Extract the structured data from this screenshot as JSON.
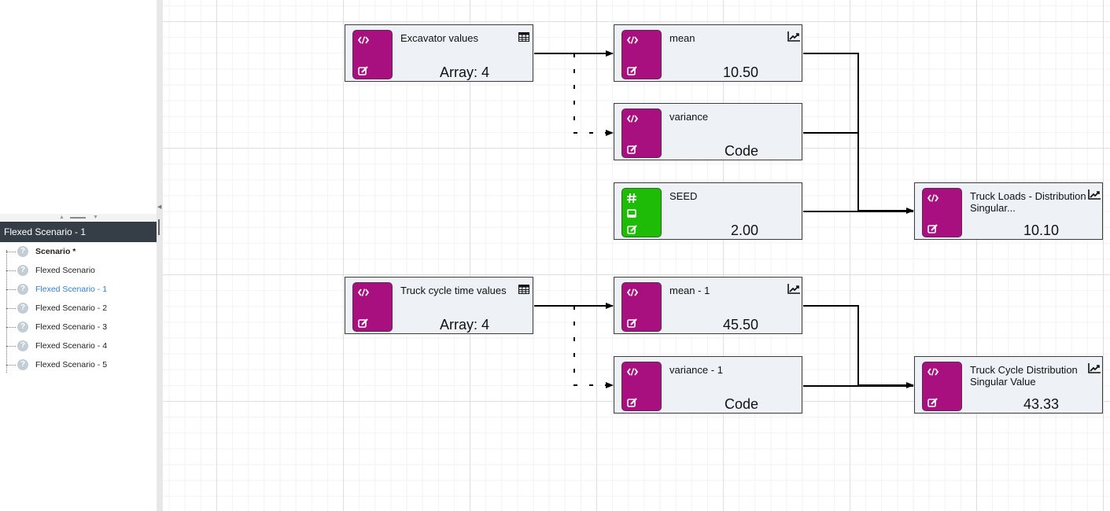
{
  "sidebar": {
    "panel_title": "Flexed Scenario - 1",
    "tree": [
      {
        "label": "Scenario *",
        "style": "bold",
        "icon": "question-icon"
      },
      {
        "label": "Flexed Scenario",
        "style": "normal",
        "icon": "question-icon"
      },
      {
        "label": "Flexed Scenario - 1",
        "style": "active",
        "icon": "question-icon"
      },
      {
        "label": "Flexed Scenario - 2",
        "style": "normal",
        "icon": "question-icon"
      },
      {
        "label": "Flexed Scenario - 3",
        "style": "normal",
        "icon": "question-icon"
      },
      {
        "label": "Flexed Scenario - 4",
        "style": "normal",
        "icon": "question-icon"
      },
      {
        "label": "Flexed Scenario - 5",
        "style": "normal",
        "icon": "question-icon"
      }
    ]
  },
  "colors": {
    "code_node": "#a8107f",
    "input_node": "#1ebc07",
    "active_item": "#2d7fd8",
    "panel_header": "#353e46"
  },
  "nodes": {
    "excavator_values": {
      "title": "Excavator values",
      "value": "Array:  4",
      "type": "code",
      "corner_icon": "table-icon"
    },
    "mean": {
      "title": "mean",
      "value": "10.50",
      "type": "code",
      "corner_icon": "chart-icon"
    },
    "variance": {
      "title": "variance",
      "value": "Code",
      "type": "code",
      "corner_icon": ""
    },
    "seed": {
      "title": "SEED",
      "value": "2.00",
      "type": "input",
      "corner_icon": ""
    },
    "truck_loads": {
      "title": "Truck Loads - Distribution Singular...",
      "value": "10.10",
      "type": "code",
      "corner_icon": "chart-icon"
    },
    "truck_cycle_values": {
      "title": "Truck cycle time values",
      "value": "Array:  4",
      "type": "code",
      "corner_icon": "table-icon"
    },
    "mean_1": {
      "title": "mean - 1",
      "value": "45.50",
      "type": "code",
      "corner_icon": "chart-icon"
    },
    "variance_1": {
      "title": "variance - 1",
      "value": "Code",
      "type": "code",
      "corner_icon": ""
    },
    "truck_cycle_dist": {
      "title": "Truck Cycle Distribution Singular Value",
      "value": "43.33",
      "type": "code",
      "corner_icon": "chart-icon"
    }
  },
  "edges": [
    {
      "from": "excavator_values",
      "to": "mean",
      "style": "solid"
    },
    {
      "from": "excavator_values",
      "to": "variance",
      "style": "dashed"
    },
    {
      "from": "mean",
      "to": "truck_loads",
      "style": "solid"
    },
    {
      "from": "variance",
      "to": "truck_loads",
      "style": "solid"
    },
    {
      "from": "seed",
      "to": "truck_loads",
      "style": "solid"
    },
    {
      "from": "truck_cycle_values",
      "to": "mean_1",
      "style": "solid"
    },
    {
      "from": "truck_cycle_values",
      "to": "variance_1",
      "style": "dashed"
    },
    {
      "from": "mean_1",
      "to": "truck_cycle_dist",
      "style": "solid"
    },
    {
      "from": "variance_1",
      "to": "truck_cycle_dist",
      "style": "solid"
    }
  ]
}
